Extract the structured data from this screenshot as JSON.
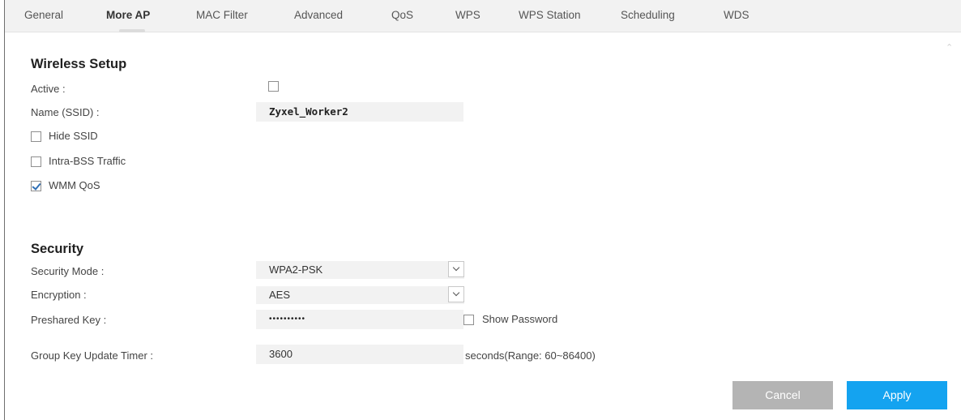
{
  "tabs": [
    {
      "label": "General"
    },
    {
      "label": "More AP"
    },
    {
      "label": "MAC Filter"
    },
    {
      "label": "Advanced"
    },
    {
      "label": "QoS"
    },
    {
      "label": "WPS"
    },
    {
      "label": "WPS Station"
    },
    {
      "label": "Scheduling"
    },
    {
      "label": "WDS"
    }
  ],
  "active_tab": "More AP",
  "wireless_setup": {
    "title": "Wireless Setup",
    "active_label": "Active :",
    "active_checked": false,
    "ssid_label": "Name (SSID) :",
    "ssid_value": "Zyxel_Worker2",
    "hide_ssid_label": "Hide SSID",
    "hide_ssid_checked": false,
    "intra_bss_label": "Intra-BSS Traffic",
    "intra_bss_checked": false,
    "wmm_qos_label": "WMM QoS",
    "wmm_qos_checked": true
  },
  "security": {
    "title": "Security",
    "mode_label": "Security Mode :",
    "mode_value": "WPA2-PSK",
    "encryption_label": "Encryption :",
    "encryption_value": "AES",
    "preshared_label": "Preshared Key :",
    "preshared_value": "••••••••••",
    "show_password_label": "Show Password",
    "show_password_checked": false,
    "group_key_label": "Group Key Update Timer :",
    "group_key_value": "3600",
    "group_key_suffix": "seconds(Range: 60~86400)"
  },
  "buttons": {
    "cancel": "Cancel",
    "apply": "Apply"
  },
  "colors": {
    "apply_bg": "#14a3f0",
    "cancel_bg": "#b4b4b4",
    "tab_bar_bg": "#f2f2f2"
  }
}
